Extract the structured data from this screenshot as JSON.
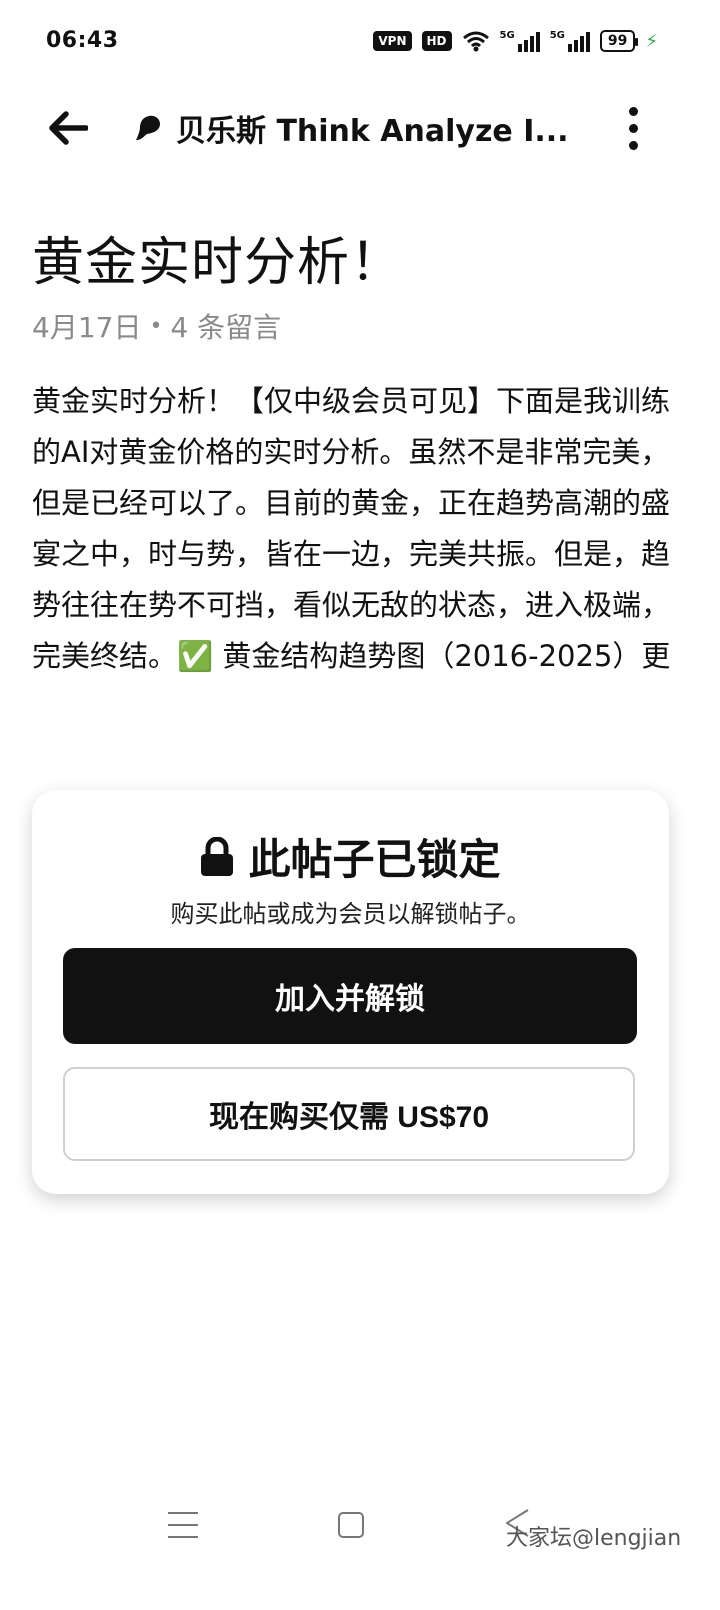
{
  "status_bar": {
    "time": "06:43",
    "vpn": "VPN",
    "hd": "HD",
    "signal1": "5G",
    "signal2": "5G",
    "battery": "99"
  },
  "app_bar": {
    "creator_name": "贝乐斯 Think Analyze I..."
  },
  "post": {
    "title": "黄金实时分析！",
    "date": "4月17日",
    "comments": "4 条留言",
    "body": "黄金实时分析！【仅中级会员可见】下面是我训练的AI对黄金价格的实时分析。虽然不是非常完美，但是已经可以了。目前的黄金，正在趋势高潮的盛宴之中，时与势，皆在一边，完美共振。但是，趋势往往在势不可挡，看似无敌的状态，进入极端，完美终结。✅ 黄金结构趋势图（2016-2025）更"
  },
  "lock_card": {
    "title": "此帖子已锁定",
    "subtitle": "购买此帖或成为会员以解锁帖子。",
    "join_label": "加入并解锁",
    "buy_label": "现在购买仅需 US$70"
  },
  "watermark": "大家坛@lengjian"
}
